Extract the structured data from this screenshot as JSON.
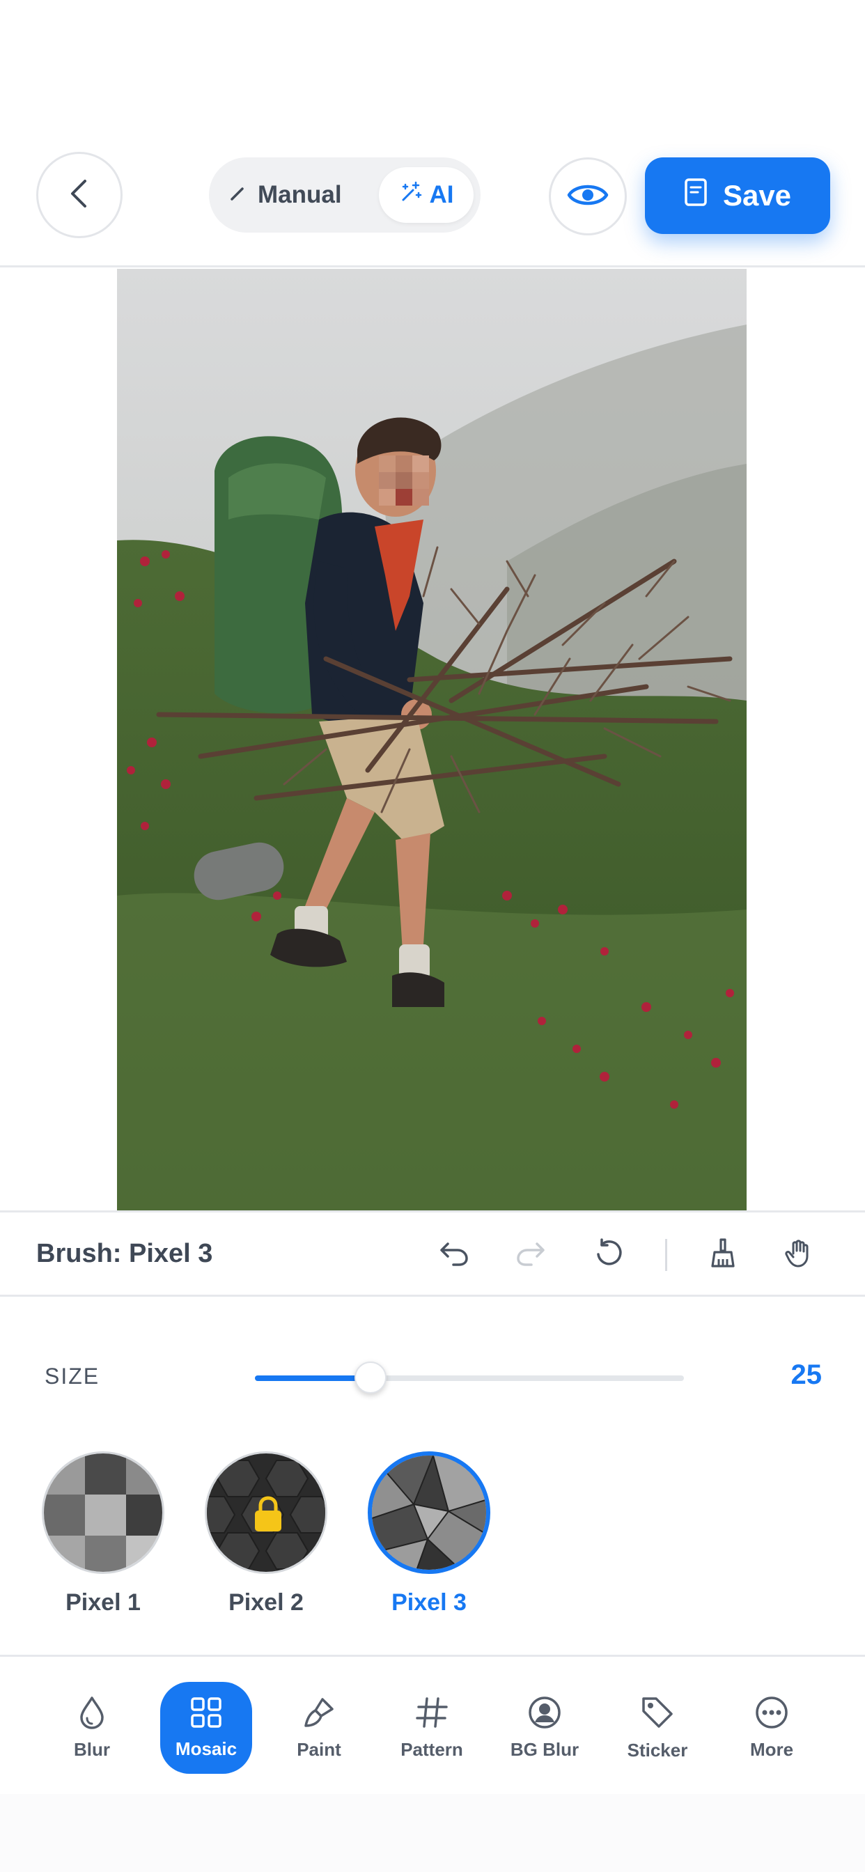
{
  "header": {
    "mode_manual_label": "Manual",
    "mode_ai_label": "AI",
    "save_label": "Save"
  },
  "brush": {
    "title": "Brush: Pixel 3"
  },
  "size": {
    "label": "SIZE",
    "value": "25",
    "slider_fraction": 0.27
  },
  "presets": [
    {
      "label": "Pixel 1",
      "locked": false,
      "selected": false
    },
    {
      "label": "Pixel 2",
      "locked": true,
      "selected": false
    },
    {
      "label": "Pixel 3",
      "locked": false,
      "selected": true
    }
  ],
  "tabs": [
    {
      "label": "Blur",
      "icon": "drop-icon"
    },
    {
      "label": "Mosaic",
      "icon": "grid-icon",
      "active": true
    },
    {
      "label": "Paint",
      "icon": "brush-icon"
    },
    {
      "label": "Pattern",
      "icon": "hash-icon"
    },
    {
      "label": "BG Blur",
      "icon": "user-circle-icon"
    },
    {
      "label": "Sticker",
      "icon": "tag-icon"
    },
    {
      "label": "More",
      "icon": "more-icon"
    }
  ],
  "colors": {
    "accent": "#1778f2",
    "text": "#3c4554",
    "lock": "#f5c518"
  }
}
